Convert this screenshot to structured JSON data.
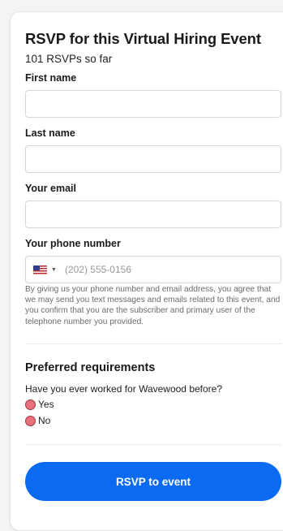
{
  "form": {
    "title": "RSVP for this Virtual Hiring Event",
    "rsvp_count": "101 RSVPs so far",
    "fields": {
      "first_name": {
        "label": "First name",
        "value": ""
      },
      "last_name": {
        "label": "Last name",
        "value": ""
      },
      "email": {
        "label": "Your email",
        "value": ""
      },
      "phone": {
        "label": "Your phone number",
        "placeholder": "(202) 555-0156",
        "country": "US"
      }
    },
    "consent_text": "By giving us your phone number and email address, you agree that we may send you text messages and emails related to this event, and you confirm that you are the subscriber and primary user of the telephone number you provided.",
    "requirements": {
      "title": "Preferred requirements",
      "question": "Have you ever worked for Wavewood before?",
      "options": [
        {
          "label": "Yes",
          "selected": false
        },
        {
          "label": "No",
          "selected": false
        }
      ]
    },
    "submit_label": "RSVP to event"
  },
  "colors": {
    "primary_button": "#0a6bf2",
    "radio_fill": "#e8707a"
  },
  "icons": {
    "country_flag": "us-flag-icon",
    "dropdown": "caret-down-icon"
  }
}
